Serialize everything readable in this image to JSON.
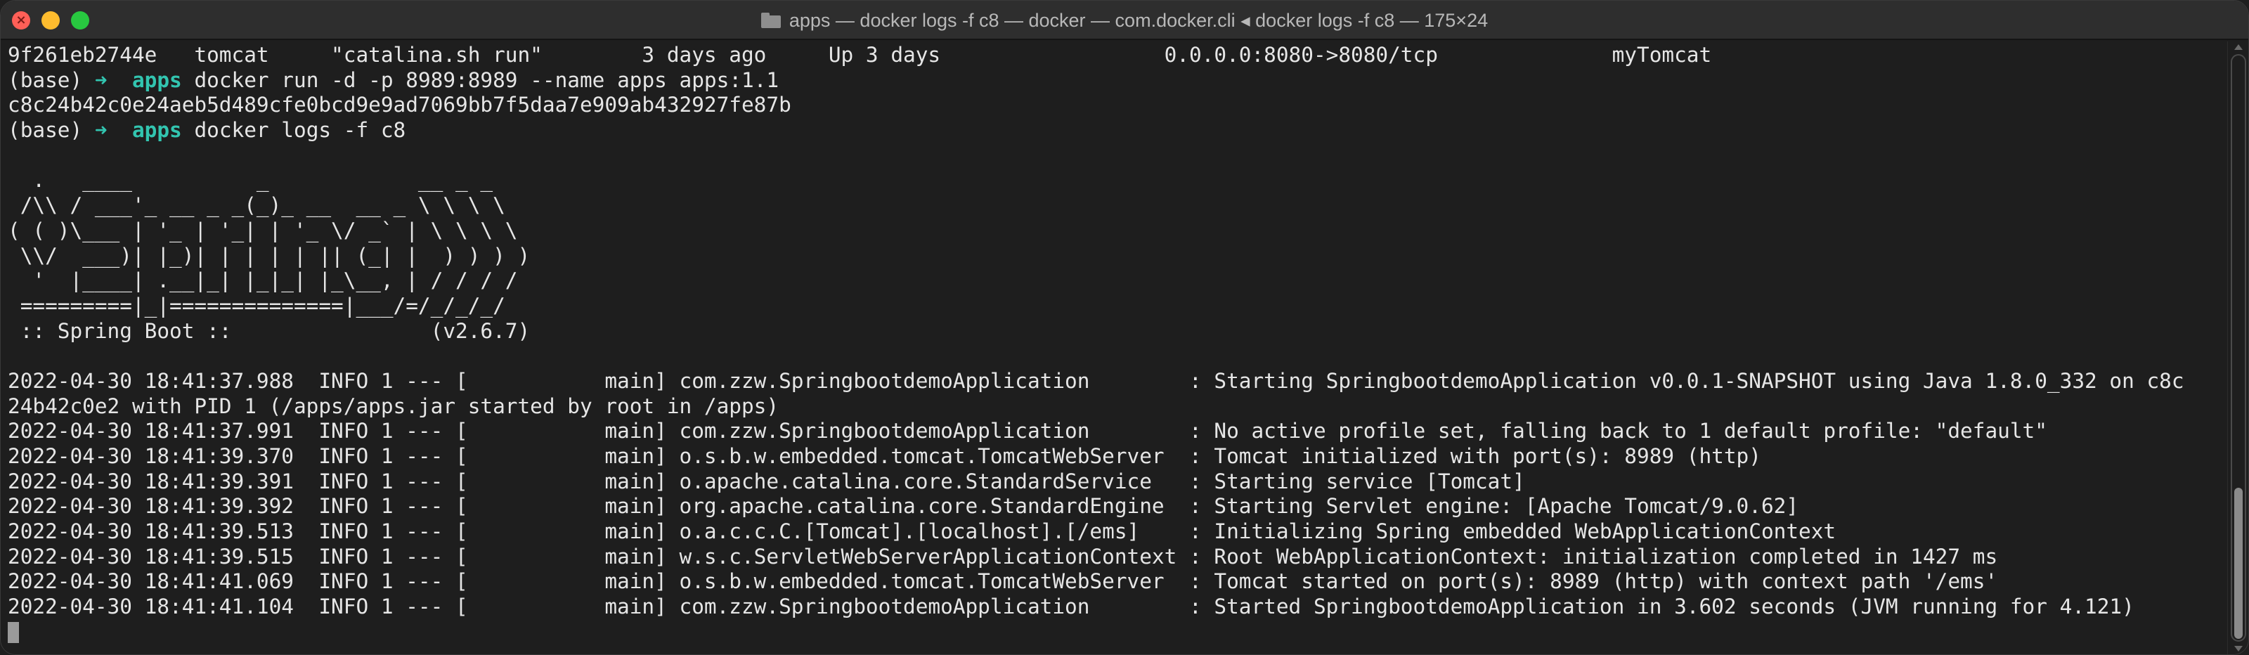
{
  "window": {
    "title": "apps — docker logs -f c8 — docker — com.docker.cli ◂ docker logs -f c8 — 175×24",
    "close_glyph": "×"
  },
  "terminal": {
    "prompt": {
      "env": "(base)",
      "arrow": "➜",
      "dir": "apps"
    },
    "lines": [
      {
        "text": "9f261eb2744e   tomcat     \"catalina.sh run\"        3 days ago     Up 3 days                  0.0.0.0:8080->8080/tcp              myTomcat"
      },
      {
        "prompt": true,
        "text": " docker run -d -p 8989:8989 --name apps apps:1.1"
      },
      {
        "text": "c8c24b42c0e24aeb5d489cfe0bcd9e9ad7069bb7f5daa7e909ab432927fe87b"
      },
      {
        "prompt": true,
        "text": " docker logs -f c8"
      },
      {
        "text": ""
      },
      {
        "text": "  .   ____          _            __ _ _"
      },
      {
        "text": " /\\\\ / ___'_ __ _ _(_)_ __  __ _ \\ \\ \\ \\"
      },
      {
        "text": "( ( )\\___ | '_ | '_| | '_ \\/ _` | \\ \\ \\ \\"
      },
      {
        "text": " \\\\/  ___)| |_)| | | | | || (_| |  ) ) ) )"
      },
      {
        "text": "  '  |____| .__|_| |_|_| |_\\__, | / / / /"
      },
      {
        "text": " =========|_|==============|___/=/_/_/_/"
      },
      {
        "text": " :: Spring Boot ::                (v2.6.7)"
      },
      {
        "text": ""
      },
      {
        "text": "2022-04-30 18:41:37.988  INFO 1 --- [           main] com.zzw.SpringbootdemoApplication        : Starting SpringbootdemoApplication v0.0.1-SNAPSHOT using Java 1.8.0_332 on c8c"
      },
      {
        "text": "24b42c0e2 with PID 1 (/apps/apps.jar started by root in /apps)"
      },
      {
        "text": "2022-04-30 18:41:37.991  INFO 1 --- [           main] com.zzw.SpringbootdemoApplication        : No active profile set, falling back to 1 default profile: \"default\""
      },
      {
        "text": "2022-04-30 18:41:39.370  INFO 1 --- [           main] o.s.b.w.embedded.tomcat.TomcatWebServer  : Tomcat initialized with port(s): 8989 (http)"
      },
      {
        "text": "2022-04-30 18:41:39.391  INFO 1 --- [           main] o.apache.catalina.core.StandardService   : Starting service [Tomcat]"
      },
      {
        "text": "2022-04-30 18:41:39.392  INFO 1 --- [           main] org.apache.catalina.core.StandardEngine  : Starting Servlet engine: [Apache Tomcat/9.0.62]"
      },
      {
        "text": "2022-04-30 18:41:39.513  INFO 1 --- [           main] o.a.c.c.C.[Tomcat].[localhost].[/ems]    : Initializing Spring embedded WebApplicationContext"
      },
      {
        "text": "2022-04-30 18:41:39.515  INFO 1 --- [           main] w.s.c.ServletWebServerApplicationContext : Root WebApplicationContext: initialization completed in 1427 ms"
      },
      {
        "text": "2022-04-30 18:41:41.069  INFO 1 --- [           main] o.s.b.w.embedded.tomcat.TomcatWebServer  : Tomcat started on port(s): 8989 (http) with context path '/ems'"
      },
      {
        "text": "2022-04-30 18:41:41.104  INFO 1 --- [           main] com.zzw.SpringbootdemoApplication        : Started SpringbootdemoApplication in 3.602 seconds (JVM running for 4.121)"
      },
      {
        "cursor": true,
        "text": ""
      }
    ]
  },
  "scrollbar": {
    "position_fraction": 0.74,
    "visible_fraction": 0.26
  },
  "colors": {
    "prompt_accent": "#32c5b0",
    "background": "#1e1e1e",
    "text": "#e6e6e6"
  },
  "icons": {
    "title": "folder-icon"
  }
}
